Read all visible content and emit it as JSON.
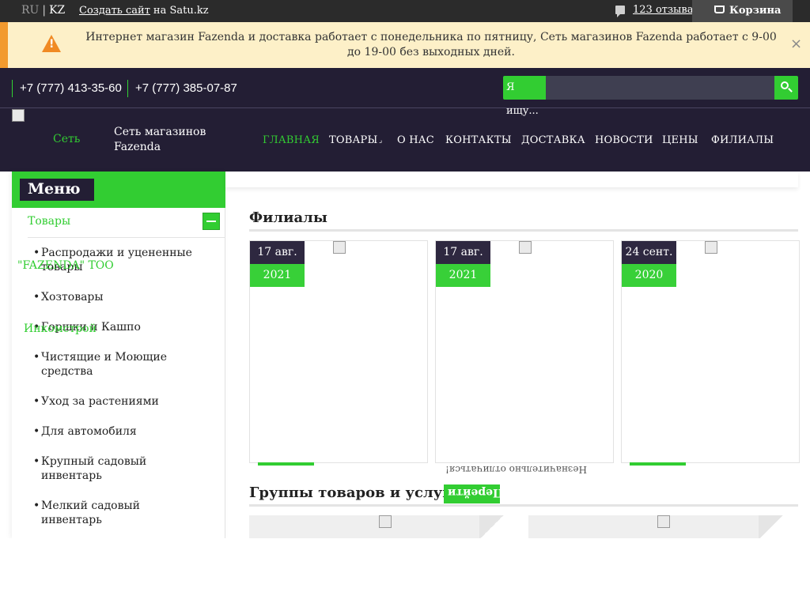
{
  "topbar": {
    "lang_ru": "RU",
    "lang_sep": "|",
    "lang_kz": "KZ",
    "create_site_link": "Создать сайт",
    "create_site_suffix": "на Satu.kz",
    "reviews_icon": "comment-icon",
    "reviews": "123 отзыва",
    "cart_icon": "cart-icon",
    "cart": "Корзина"
  },
  "notice": {
    "icon": "warning-icon",
    "icon_glyph": "!",
    "text": "Интернет магазин Fazenda и доставка работает с понедельника по пятницу, Сеть магазинов Fazenda работает с 9-00 до 19-00 без выходных дней.",
    "close": "×",
    "colors": {
      "stripe": "#f29a2e",
      "background": "#fdf0c8",
      "icon": "#f08a24"
    }
  },
  "header": {
    "phones": [
      "+7 (777) 413-35-60",
      "+7 (777) 385-07-87"
    ],
    "search": {
      "label": "Я ищу...",
      "placeholder": "",
      "button_icon": "search-icon"
    },
    "brand": "Сеть",
    "company": "Сеть магазинов Fazenda",
    "nav": {
      "home": "ГЛАВНАЯ",
      "goods": "ТОВАРЫ",
      "goods_arrow": "⌟",
      "about": "О НАС",
      "contacts": "КОНТАКТЫ",
      "delivery": "ДОСТАВКА",
      "news": "НОВОСТИ",
      "prices": "ЦЕНЫ",
      "branches": "ФИЛИАЛЫ"
    },
    "colors": {
      "background": "#231e34",
      "accent": "#32cd32"
    }
  },
  "sidebar": {
    "title": "Меню",
    "goods": "Товары",
    "items": [
      "Распродажи и уцененные товары",
      "Хозтовары",
      "Горшки и Кашпо",
      "Чистящие и Моющие средства",
      "Уход за растениями",
      "Для автомобиля",
      "Крупный садовый инвентарь",
      "Мелкий садовый инвентарь"
    ],
    "bullet": "•",
    "overlap_1": "\"FAZENDA\" ТОО",
    "overlap_2": "Инкомстрой"
  },
  "main": {
    "branches_title": "Филиалы",
    "cards": [
      {
        "day": "17 авг.",
        "year": "2021"
      },
      {
        "day": "17 авг.",
        "year": "2021"
      },
      {
        "day": "24 сент.",
        "year": "2020"
      }
    ],
    "mirrored_text": "Незначительно отличаться!",
    "groups_title": "Группы товаров и услуг",
    "goto_button": "Перейти"
  }
}
